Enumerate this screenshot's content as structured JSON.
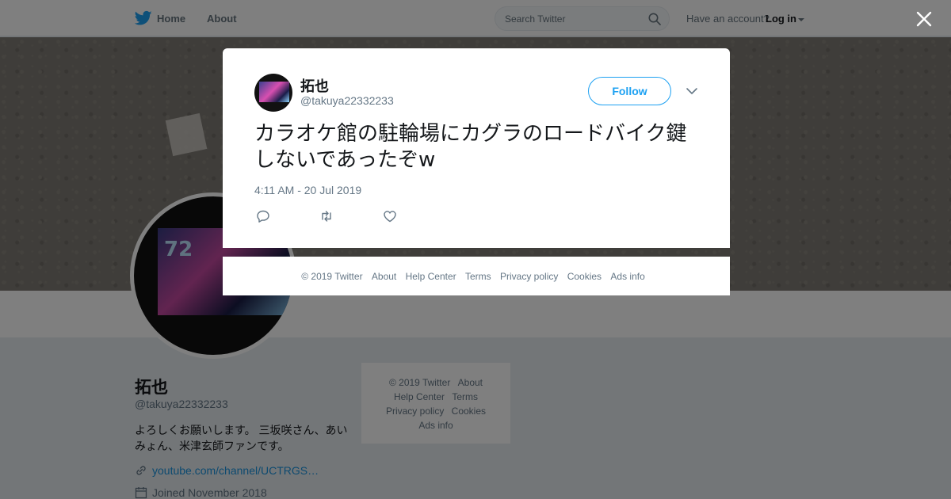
{
  "nav": {
    "home_label": "Home",
    "about_label": "About",
    "search_placeholder": "Search Twitter",
    "account_text": "Have an account?",
    "login_label": "Log in"
  },
  "profile": {
    "name": "拓也",
    "handle": "@takuya22332233",
    "bio": "よろしくお願いします。 三坂咲さん、あいみょん、米津玄師ファンです。",
    "link": "youtube.com/channel/UCTRGS…",
    "joined": "Joined November 2018"
  },
  "side_footer": {
    "items": [
      "© 2019 Twitter",
      "About",
      "Help Center",
      "Terms",
      "Privacy policy",
      "Cookies",
      "Ads info"
    ]
  },
  "tweet": {
    "name": "拓也",
    "handle": "@takuya22332233",
    "follow_label": "Follow",
    "text": "カラオケ館の駐輪場にカグラのロードバイク鍵しないであったぞw",
    "timestamp": "4:11 AM - 20 Jul 2019"
  },
  "modal_footer": {
    "items": [
      "© 2019 Twitter",
      "About",
      "Help Center",
      "Terms",
      "Privacy policy",
      "Cookies",
      "Ads info"
    ]
  },
  "colors": {
    "accent": "#1da1f2",
    "link": "#1b95e0",
    "overlay": "rgba(0,0,0,0.5)"
  }
}
